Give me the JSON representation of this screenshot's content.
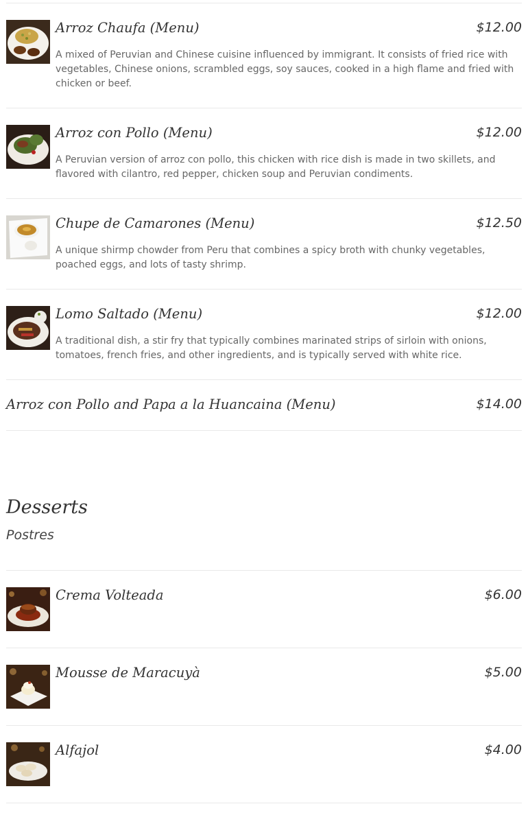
{
  "menu_items": [
    {
      "name": "Arroz Chaufa (Menu)",
      "price": "$12.00",
      "description": "A mixed of Peruvian and Chinese cuisine influenced by immigrant. It consists of fried rice with vegetables, Chinese onions, scrambled eggs, soy sauces, cooked in a high flame and fried with chicken or beef."
    },
    {
      "name": "Arroz con Pollo (Menu)",
      "price": "$12.00",
      "description": "A Peruvian version of arroz con pollo, this chicken with rice dish is made in two skillets, and flavored with cilantro, red pepper, chicken soup and Peruvian condiments."
    },
    {
      "name": "Chupe de Camarones (Menu)",
      "price": "$12.50",
      "description": "A unique shirmp chowder from Peru that combines a spicy broth with chunky vegetables, poached eggs, and lots of tasty shrimp."
    },
    {
      "name": "Lomo Saltado (Menu)",
      "price": "$12.00",
      "description": "A traditional dish, a stir fry that typically combines marinated strips of sirloin with onions, tomatoes, french fries, and other ingredients, and is typically served with white rice."
    },
    {
      "name": "Arroz con Pollo and Papa a la Huancaina (Menu)",
      "price": "$14.00"
    }
  ],
  "desserts": {
    "title": "Desserts",
    "subtitle": "Postres",
    "items": [
      {
        "name": "Crema Volteada",
        "price": "$6.00"
      },
      {
        "name": "Mousse de Maracuyà",
        "price": "$5.00"
      },
      {
        "name": "Alfajol",
        "price": "$4.00"
      }
    ]
  }
}
